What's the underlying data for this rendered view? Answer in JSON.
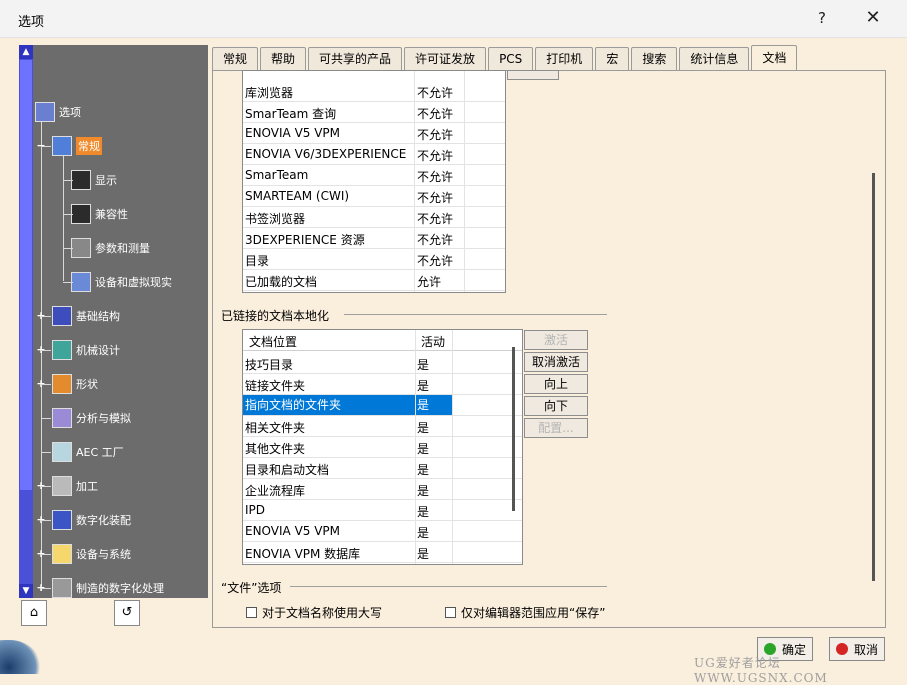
{
  "window": {
    "title": "选项",
    "help_label": "?",
    "close_label": "✕"
  },
  "tree": {
    "items": [
      {
        "label": "选项",
        "icon": "options-icon",
        "level": 0,
        "expander": ""
      },
      {
        "label": "常规",
        "icon": "general-icon",
        "level": 1,
        "expander": "−",
        "selected": true
      },
      {
        "label": "显示",
        "icon": "display-icon",
        "level": 2,
        "expander": ""
      },
      {
        "label": "兼容性",
        "icon": "compatibility-icon",
        "level": 2,
        "expander": ""
      },
      {
        "label": "参数和测量",
        "icon": "parameters-icon",
        "level": 2,
        "expander": ""
      },
      {
        "label": "设备和虚拟现实",
        "icon": "devices-vr-icon",
        "level": 2,
        "expander": ""
      },
      {
        "label": "基础结构",
        "icon": "infrastructure-icon",
        "level": 1,
        "expander": "+"
      },
      {
        "label": "机械设计",
        "icon": "mechanical-design-icon",
        "level": 1,
        "expander": "+"
      },
      {
        "label": "形状",
        "icon": "shape-icon",
        "level": 1,
        "expander": "+"
      },
      {
        "label": "分析与模拟",
        "icon": "analysis-simulation-icon",
        "level": 1,
        "expander": ""
      },
      {
        "label": "AEC 工厂",
        "icon": "aec-plant-icon",
        "level": 1,
        "expander": ""
      },
      {
        "label": "加工",
        "icon": "machining-icon",
        "level": 1,
        "expander": "+"
      },
      {
        "label": "数字化装配",
        "icon": "digital-mockup-icon",
        "level": 1,
        "expander": "+"
      },
      {
        "label": "设备与系统",
        "icon": "equipment-systems-icon",
        "level": 1,
        "expander": "+"
      },
      {
        "label": "制造的数字化处理",
        "icon": "digital-manufacturing-icon",
        "level": 1,
        "expander": "+"
      }
    ]
  },
  "tabs": [
    "常规",
    "帮助",
    "可共享的产品",
    "许可证发放",
    "PCS",
    "打印机",
    "宏",
    "搜索",
    "统计信息",
    "文档"
  ],
  "active_tab": "文档",
  "doc_env_table": {
    "rows": [
      {
        "name": "库浏览器",
        "value": "不允许"
      },
      {
        "name": "SmarTeam 查询",
        "value": "不允许"
      },
      {
        "name": "ENOVIA V5 VPM",
        "value": "不允许"
      },
      {
        "name": "ENOVIA V6/3DEXPERIENCE",
        "value": "不允许"
      },
      {
        "name": "SmarTeam",
        "value": "不允许"
      },
      {
        "name": "SMARTEAM (CWI)",
        "value": "不允许"
      },
      {
        "name": "书签浏览器",
        "value": "不允许"
      },
      {
        "name": "3DEXPERIENCE 资源",
        "value": "不允许"
      },
      {
        "name": "目录",
        "value": "不允许"
      },
      {
        "name": "已加载的文档",
        "value": "允许"
      }
    ]
  },
  "linked_docs": {
    "title": "已链接的文档本地化",
    "headers": [
      "文档位置",
      "活动"
    ],
    "rows": [
      {
        "name": "技巧目录",
        "value": "是"
      },
      {
        "name": "链接文件夹",
        "value": "是"
      },
      {
        "name": "指向文档的文件夹",
        "value": "是",
        "selected": true
      },
      {
        "name": "相关文件夹",
        "value": "是"
      },
      {
        "name": "其他文件夹",
        "value": "是"
      },
      {
        "name": "目录和启动文档",
        "value": "是"
      },
      {
        "name": "企业流程库",
        "value": "是"
      },
      {
        "name": "IPD",
        "value": "是"
      },
      {
        "name": "ENOVIA V5 VPM",
        "value": "是"
      },
      {
        "name": "ENOVIA VPM 数据库",
        "value": "是"
      }
    ],
    "buttons": {
      "activate": "激活",
      "deactivate": "取消激活",
      "up": "向上",
      "down": "向下",
      "configure": "配置..."
    }
  },
  "file_options": {
    "title": "“文件”选项",
    "uppercase_label": "对于文档名称使用大写",
    "uppercase_checked": false,
    "editor_scope_label": "仅对编辑器范围应用“保存”",
    "editor_scope_checked": false
  },
  "footer": {
    "ok_label": "确定",
    "cancel_label": "取消",
    "watermark": "UG爱好者论坛 WWW.UGSNX.COM"
  },
  "colors": {
    "tree_bg": "#6c6c6c",
    "scroll": "#4b50d8",
    "selection": "#0078d7",
    "tree_selected": "#f08a2a",
    "dialog_bg": "#faeedc"
  }
}
